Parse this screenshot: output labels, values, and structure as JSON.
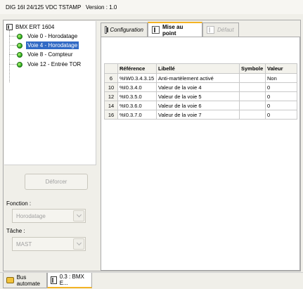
{
  "window": {
    "title": "DIG 16I 24/125 VDC TSTAMP   Version : 1.0"
  },
  "tree": {
    "root": {
      "label": "BMX ERT 1604",
      "icon": "module-icon"
    },
    "items": [
      {
        "label": "Voie 0 - Horodatage",
        "icon": "green-led-icon",
        "selected": false
      },
      {
        "label": "Voie 4 - Horodatage",
        "icon": "green-led-icon",
        "selected": true
      },
      {
        "label": "Voie 8 - Compteur",
        "icon": "green-led-icon",
        "selected": false
      },
      {
        "label": "Voie 12 - Entrée TOR",
        "icon": "green-led-icon",
        "selected": false
      }
    ]
  },
  "left_panel": {
    "deforcer_label": "Déforcer",
    "fonction_label": "Fonction :",
    "fonction_value": "Horodatage",
    "tache_label": "Tâche :",
    "tache_value": "MAST"
  },
  "tabs": [
    {
      "label": "Configuration",
      "state": "inactive"
    },
    {
      "label": "Mise au point",
      "state": "active"
    },
    {
      "label": "Défaut",
      "state": "disabled"
    }
  ],
  "table": {
    "headers": [
      "",
      "Référence",
      "Libellé",
      "Symbole",
      "Valeur"
    ],
    "rows": [
      {
        "num": "6",
        "ref": "%IW0.3.4.3.15",
        "label": "Anti-martèlement activé",
        "symbol": "",
        "value": "Non"
      },
      {
        "num": "10",
        "ref": "%I0.3.4.0",
        "label": "Valeur de la voie 4",
        "symbol": "",
        "value": "0"
      },
      {
        "num": "12",
        "ref": "%I0.3.5.0",
        "label": "Valeur de la voie 5",
        "symbol": "",
        "value": "0"
      },
      {
        "num": "14",
        "ref": "%I0.3.6.0",
        "label": "Valeur de la voie 6",
        "symbol": "",
        "value": "0"
      },
      {
        "num": "16",
        "ref": "%I0.3.7.0",
        "label": "Valeur de la voie 7",
        "symbol": "",
        "value": "0"
      }
    ]
  },
  "bottom_tabs": [
    {
      "label": "Bus automate",
      "icon": "bus-icon"
    },
    {
      "label": "0.3 : BMX E...",
      "icon": "module-icon"
    }
  ],
  "colors": {
    "selection": "#316ac5",
    "active_tab_accent": "#f3b325",
    "led_green": "#24a318"
  }
}
